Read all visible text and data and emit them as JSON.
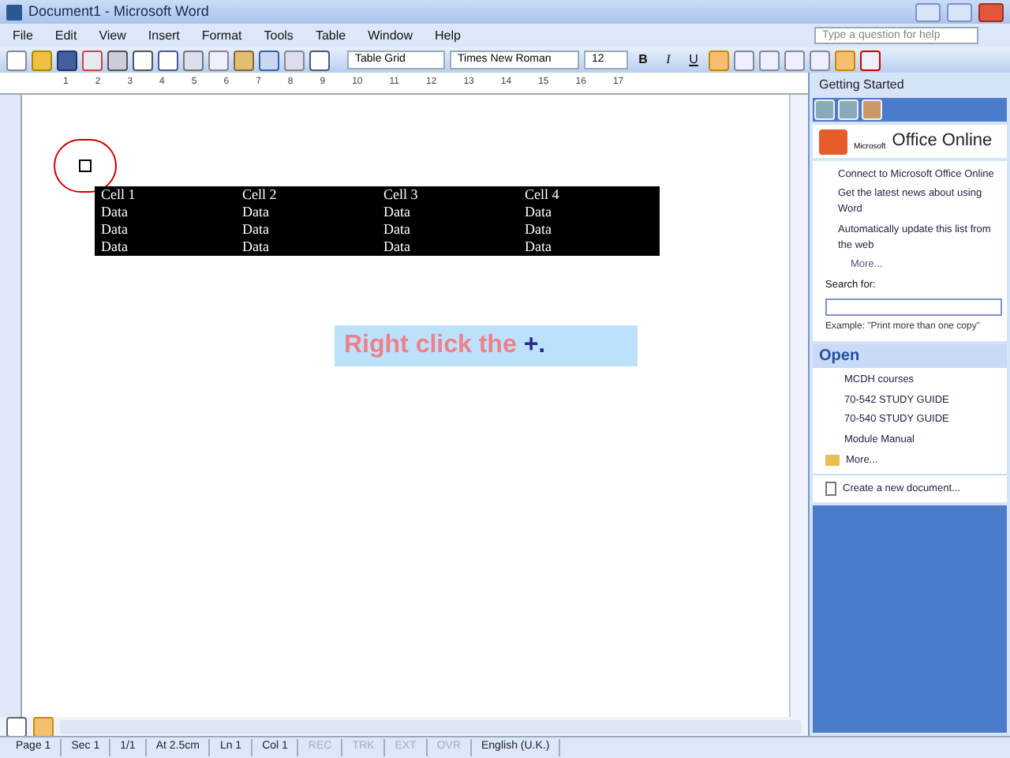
{
  "window": {
    "title": "Document1 - Microsoft Word"
  },
  "menu": [
    "File",
    "Edit",
    "View",
    "Insert",
    "Format",
    "Tools",
    "Table",
    "Window",
    "Help"
  ],
  "help_search": {
    "placeholder": "Type a question for help"
  },
  "formatting": {
    "style": "Table Grid",
    "font": "Times New Roman",
    "size": "12"
  },
  "format_buttons": [
    {
      "label": "B",
      "kind": "bold"
    },
    {
      "label": "I",
      "kind": "italic"
    },
    {
      "label": "U",
      "kind": "underline"
    }
  ],
  "ruler": [
    "1",
    "2",
    "3",
    "4",
    "5",
    "6",
    "7",
    "8",
    "9",
    "10",
    "11",
    "12",
    "13",
    "14",
    "15",
    "16",
    "17"
  ],
  "table": {
    "selected": true,
    "rows": [
      [
        "Cell 1",
        "Cell 2",
        "Cell 3",
        "Cell 4"
      ],
      [
        "Data",
        "Data",
        "Data",
        "Data"
      ],
      [
        "Data",
        "Data",
        "Data",
        "Data"
      ],
      [
        "Data",
        "Data",
        "Data",
        "Data"
      ]
    ]
  },
  "callout": {
    "text": "Right click the",
    "emphasis": "+."
  },
  "task_pane": {
    "title": "Getting Started",
    "brand_small": "Microsoft",
    "brand": "Office Online",
    "links": [
      "Connect to Microsoft Office Online",
      "Get the latest news about using Word",
      "Automatically update this list from the web"
    ],
    "more": "More...",
    "search_label": "Search for:",
    "example": "Example:  \"Print more than one copy\"",
    "open_title": "Open",
    "files": [
      "MCDH courses",
      "70-542 STUDY GUIDE",
      "70-540 STUDY GUIDE",
      "Module Manual"
    ],
    "open_more": "More...",
    "create": "Create a new document..."
  },
  "status_bar": [
    {
      "text": "Page 1",
      "disabled": false
    },
    {
      "text": "Sec 1",
      "disabled": false
    },
    {
      "text": "1/1",
      "disabled": false
    },
    {
      "text": "At 2.5cm",
      "disabled": false
    },
    {
      "text": "Ln 1",
      "disabled": false
    },
    {
      "text": "Col 1",
      "disabled": false
    },
    {
      "text": "REC",
      "disabled": true
    },
    {
      "text": "TRK",
      "disabled": true
    },
    {
      "text": "EXT",
      "disabled": true
    },
    {
      "text": "OVR",
      "disabled": true
    },
    {
      "text": "English (U.K.)",
      "disabled": false
    }
  ]
}
